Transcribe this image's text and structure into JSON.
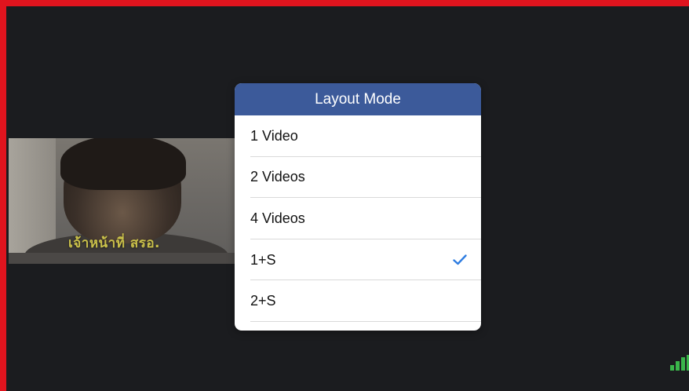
{
  "participant": {
    "name": "เจ้าหน้าที่ สรอ."
  },
  "layout_menu": {
    "title": "Layout Mode",
    "options": [
      {
        "label": "1 Video",
        "selected": false
      },
      {
        "label": "2 Videos",
        "selected": false
      },
      {
        "label": "4 Videos",
        "selected": false
      },
      {
        "label": "1+S",
        "selected": true
      },
      {
        "label": "2+S",
        "selected": false
      }
    ]
  },
  "colors": {
    "header": "#3c5a9a",
    "checkmark": "#2f7de1",
    "name_tag": "#c9c04a",
    "signal": "#3ab54a",
    "frame": "#e0141e"
  },
  "icons": {
    "checkmark": "check-icon",
    "signal": "signal-strength-icon"
  }
}
